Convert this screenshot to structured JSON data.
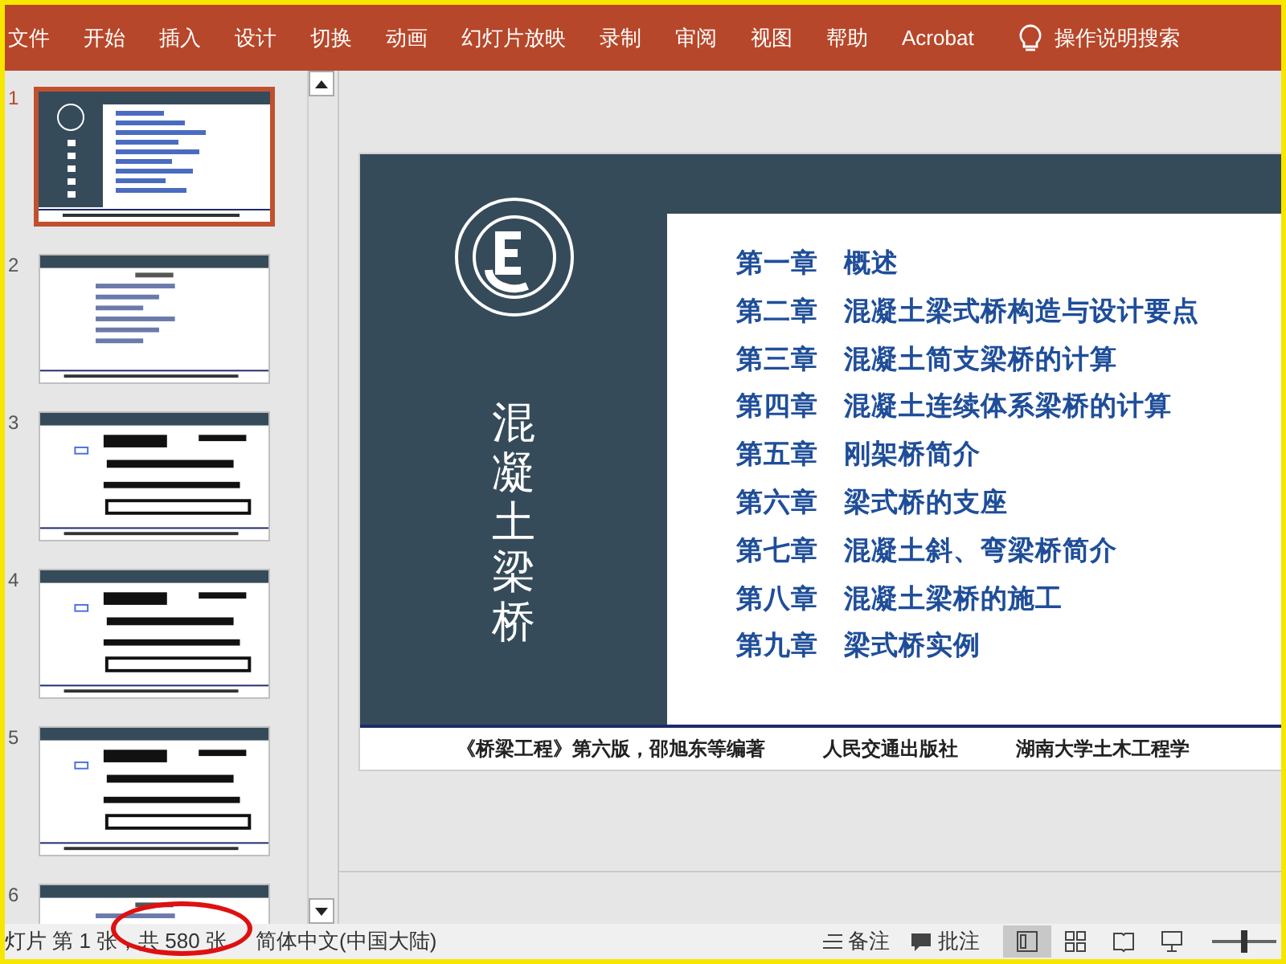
{
  "ribbon_tabs": [
    {
      "label": "文件"
    },
    {
      "label": "开始"
    },
    {
      "label": "插入"
    },
    {
      "label": "设计"
    },
    {
      "label": "切换"
    },
    {
      "label": "动画"
    },
    {
      "label": "幻灯片放映"
    },
    {
      "label": "录制"
    },
    {
      "label": "审阅"
    },
    {
      "label": "视图"
    },
    {
      "label": "帮助"
    },
    {
      "label": "Acrobat"
    }
  ],
  "search": {
    "label": "操作说明搜索"
  },
  "thumbnails": [
    {
      "number": "1",
      "selected": true,
      "kind": "title"
    },
    {
      "number": "2",
      "selected": false,
      "kind": "text"
    },
    {
      "number": "3",
      "selected": false,
      "kind": "diagram"
    },
    {
      "number": "4",
      "selected": false,
      "kind": "diagram"
    },
    {
      "number": "5",
      "selected": false,
      "kind": "diagram"
    },
    {
      "number": "6",
      "selected": false,
      "kind": "text"
    }
  ],
  "slide": {
    "vertical_title": "混凝土梁桥",
    "chapters": [
      {
        "number": "第一章",
        "title": "概述"
      },
      {
        "number": "第二章",
        "title": "混凝土梁式桥构造与设计要点"
      },
      {
        "number": "第三章",
        "title": "混凝土简支梁桥的计算"
      },
      {
        "number": "第四章",
        "title": "混凝土连续体系梁桥的计算"
      },
      {
        "number": "第五章",
        "title": "刚架桥简介"
      },
      {
        "number": "第六章",
        "title": "梁式桥的支座"
      },
      {
        "number": "第七章",
        "title": "混凝土斜、弯梁桥简介"
      },
      {
        "number": "第八章",
        "title": "混凝土梁桥的施工"
      },
      {
        "number": "第九章",
        "title": "梁式桥实例"
      }
    ],
    "footer": [
      "《桥梁工程》第六版，邵旭东等编著",
      "人民交通出版社",
      "湖南大学土木工程学"
    ]
  },
  "status_bar": {
    "slide_count": "灯片 第 1 张，共 580 张",
    "language": "简体中文(中国大陆)",
    "notes": "备注",
    "comments": "批注",
    "views": [
      {
        "kind": "normal",
        "selected": true
      },
      {
        "kind": "sorter",
        "selected": false
      },
      {
        "kind": "reading",
        "selected": false
      },
      {
        "kind": "show",
        "selected": false
      }
    ],
    "zoom": {
      "level": 0.5
    }
  }
}
